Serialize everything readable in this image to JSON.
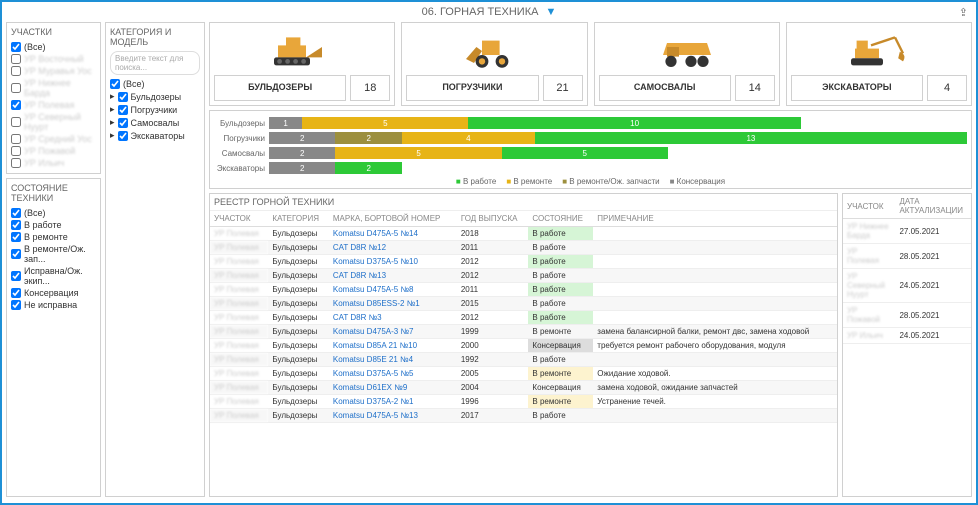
{
  "header": {
    "title": "06. ГОРНАЯ ТЕХНИКА"
  },
  "filters": {
    "uchastki": {
      "title": "УЧАСТКИ",
      "items": [
        {
          "label": "(Все)",
          "checked": true,
          "blur": false
        },
        {
          "label": "УР Восточный",
          "checked": false,
          "blur": true
        },
        {
          "label": "УР Муравья Уос",
          "checked": false,
          "blur": true
        },
        {
          "label": "УР Нижнее Барда",
          "checked": false,
          "blur": true
        },
        {
          "label": "УР Полевая",
          "checked": true,
          "blur": true
        },
        {
          "label": "УР Северный Нуурт",
          "checked": false,
          "blur": true
        },
        {
          "label": "УР Средний Уос",
          "checked": false,
          "blur": true
        },
        {
          "label": "УР Пожавой",
          "checked": false,
          "blur": true
        },
        {
          "label": "УР Ильич",
          "checked": false,
          "blur": true
        }
      ]
    },
    "category": {
      "title": "КАТЕГОРИЯ И МОДЕЛЬ",
      "search_placeholder": "Введите текст для поиска...",
      "items": [
        {
          "label": "(Все)",
          "checked": true,
          "expand": false
        },
        {
          "label": "Бульдозеры",
          "checked": true,
          "expand": true
        },
        {
          "label": "Погрузчики",
          "checked": true,
          "expand": true
        },
        {
          "label": "Самосвалы",
          "checked": true,
          "expand": true
        },
        {
          "label": "Экскаваторы",
          "checked": true,
          "expand": true
        }
      ]
    },
    "status": {
      "title": "СОСТОЯНИЕ ТЕХНИКИ",
      "items": [
        {
          "label": "(Все)",
          "checked": true
        },
        {
          "label": "В работе",
          "checked": true
        },
        {
          "label": "В ремонте",
          "checked": true
        },
        {
          "label": "В ремонте/Ож. зап...",
          "checked": true
        },
        {
          "label": "Исправна/Ож. экип...",
          "checked": true
        },
        {
          "label": "Консервация",
          "checked": true
        },
        {
          "label": "Не исправна",
          "checked": true
        }
      ]
    }
  },
  "cards": [
    {
      "label": "БУЛЬДОЗЕРЫ",
      "count": 18
    },
    {
      "label": "ПОГРУЗЧИКИ",
      "count": 21
    },
    {
      "label": "САМОСВАЛЫ",
      "count": 14
    },
    {
      "label": "ЭКСКАВАТОРЫ",
      "count": 4
    }
  ],
  "chart_data": {
    "type": "bar",
    "orientation": "horizontal",
    "stacked": true,
    "categories": [
      "Бульдозеры",
      "Погрузчики",
      "Самосвалы",
      "Экскаваторы"
    ],
    "series": [
      {
        "name": "Консервация",
        "color": "#888",
        "values": [
          1,
          2,
          2,
          2
        ]
      },
      {
        "name": "В ремонте/Ож. запчасти",
        "color": "#9c8f3e",
        "values": [
          0,
          2,
          0,
          0
        ]
      },
      {
        "name": "В ремонте",
        "color": "#e7b416",
        "values": [
          5,
          4,
          5,
          0
        ]
      },
      {
        "name": "В работе",
        "color": "#2dc937",
        "values": [
          10,
          13,
          5,
          2
        ]
      }
    ],
    "legend": [
      "В работе",
      "В ремонте",
      "В ремонте/Ож. запчасти",
      "Консервация"
    ]
  },
  "registry": {
    "title": "РЕЕСТР ГОРНОЙ ТЕХНИКИ",
    "headers": [
      "УЧАСТОК",
      "КАТЕГОРИЯ",
      "МАРКА, БОРТОВОЙ НОМЕР",
      "ГОД ВЫПУСКА",
      "СОСТОЯНИЕ",
      "ПРИМЕЧАНИЕ"
    ],
    "rows": [
      {
        "u": "УР Полевая",
        "cat": "Бульдозеры",
        "model": "Komatsu D475A-5 №14",
        "year": "2018",
        "status": "В работе",
        "st": "work",
        "note": ""
      },
      {
        "u": "УР Полевая",
        "cat": "Бульдозеры",
        "model": "CAT D8R №12",
        "year": "2011",
        "status": "В работе",
        "st": "work",
        "note": ""
      },
      {
        "u": "УР Полевая",
        "cat": "Бульдозеры",
        "model": "Komatsu D375A-5 №10",
        "year": "2012",
        "status": "В работе",
        "st": "work",
        "note": ""
      },
      {
        "u": "УР Полевая",
        "cat": "Бульдозеры",
        "model": "CAT D8R №13",
        "year": "2012",
        "status": "В работе",
        "st": "work",
        "note": ""
      },
      {
        "u": "УР Полевая",
        "cat": "Бульдозеры",
        "model": "Komatsu D475A-5 №8",
        "year": "2011",
        "status": "В работе",
        "st": "work",
        "note": ""
      },
      {
        "u": "УР Полевая",
        "cat": "Бульдозеры",
        "model": "Komatsu D85ESS-2 №1",
        "year": "2015",
        "status": "В работе",
        "st": "work",
        "note": ""
      },
      {
        "u": "УР Полевая",
        "cat": "Бульдозеры",
        "model": "CAT D8R №3",
        "year": "2012",
        "status": "В работе",
        "st": "work",
        "note": ""
      },
      {
        "u": "УР Полевая",
        "cat": "Бульдозеры",
        "model": "Komatsu D475A-3 №7",
        "year": "1999",
        "status": "В ремонте",
        "st": "repair",
        "note": "замена балансирной балки, ремонт двс, замена ходовой"
      },
      {
        "u": "УР Полевая",
        "cat": "Бульдозеры",
        "model": "Komatsu D85A 21 №10",
        "year": "2000",
        "status": "Консервация",
        "st": "cons",
        "note": "требуется ремонт рабочего оборудования, модуля"
      },
      {
        "u": "УР Полевая",
        "cat": "Бульдозеры",
        "model": "Komatsu D85E 21 №4",
        "year": "1992",
        "status": "В работе",
        "st": "work",
        "note": ""
      },
      {
        "u": "УР Полевая",
        "cat": "Бульдозеры",
        "model": "Komatsu D375A-5 №5",
        "year": "2005",
        "status": "В ремонте",
        "st": "repair",
        "note": "Ожидание ходовой."
      },
      {
        "u": "УР Полевая",
        "cat": "Бульдозеры",
        "model": "Komatsu D61EX №9",
        "year": "2004",
        "status": "Консервация",
        "st": "cons",
        "note": "замена ходовой, ожидание запчастей"
      },
      {
        "u": "УР Полевая",
        "cat": "Бульдозеры",
        "model": "Komatsu D375A-2 №1",
        "year": "1996",
        "status": "В ремонте",
        "st": "repair",
        "note": "Устранение течей."
      },
      {
        "u": "УР Полевая",
        "cat": "Бульдозеры",
        "model": "Komatsu D475A-5 №13",
        "year": "2017",
        "status": "В работе",
        "st": "work",
        "note": ""
      }
    ]
  },
  "right": {
    "headers": [
      "УЧАСТОК",
      "ДАТА АКТУАЛИЗАЦИИ"
    ],
    "rows": [
      {
        "u": "УР Нижнее Барда",
        "date": "27.05.2021"
      },
      {
        "u": "УР Полевая",
        "date": "28.05.2021"
      },
      {
        "u": "УР Северный Нуурт",
        "date": "24.05.2021"
      },
      {
        "u": "УР Пожавой",
        "date": "28.05.2021"
      },
      {
        "u": "УР Ильич",
        "date": "24.05.2021"
      }
    ]
  }
}
